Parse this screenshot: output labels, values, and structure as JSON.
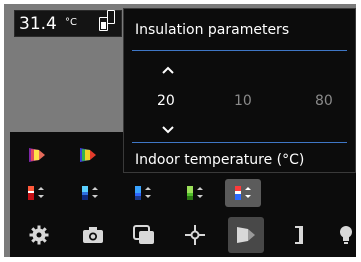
{
  "status": {
    "temperature": "31.4",
    "unit": "°C"
  },
  "popup": {
    "title": "Insulation parameters",
    "values": [
      "20",
      "10",
      "80"
    ],
    "footer": "Indoor temperature (°C)"
  },
  "colors": {
    "accent": "#3f77c6",
    "background": "#7b7b7b",
    "panel": "#0c0c0c"
  },
  "palettes_row1": [
    {
      "name": "iron-palette-icon",
      "colors": [
        "#ffe14a",
        "#e34a5f",
        "#7e27a8",
        "#3a1b70"
      ]
    },
    {
      "name": "rainbow-palette-icon",
      "colors": [
        "#3b40d6",
        "#35b44a",
        "#f0d22a",
        "#e23b2b"
      ]
    }
  ],
  "palettes_row2": [
    {
      "name": "iron-alarm-icon",
      "colors": [
        "#ff5a3c",
        "#ffffff",
        "#c40f15"
      ]
    },
    {
      "name": "blue-alarm-icon",
      "colors": [
        "#5bd0ff",
        "#2c6fe0",
        "#0e2a80"
      ]
    },
    {
      "name": "blue-scale-icon",
      "colors": [
        "#2d65ff",
        "#39a3ff",
        "#1b3a8e"
      ]
    },
    {
      "name": "green-scale-icon",
      "colors": [
        "#9be05a",
        "#53c12c",
        "#2b7a13"
      ]
    },
    {
      "name": "multi-alarm-icon",
      "colors": [
        "#ff3b3b",
        "#ffffff",
        "#2d6bff"
      ]
    }
  ],
  "toolbar": [
    {
      "name": "settings-gear-icon"
    },
    {
      "name": "camera-icon"
    },
    {
      "name": "image-mode-icon"
    },
    {
      "name": "measurement-spot-icon"
    },
    {
      "name": "palette-icon"
    },
    {
      "name": "scale-bracket-icon"
    },
    {
      "name": "lamp-icon"
    }
  ]
}
